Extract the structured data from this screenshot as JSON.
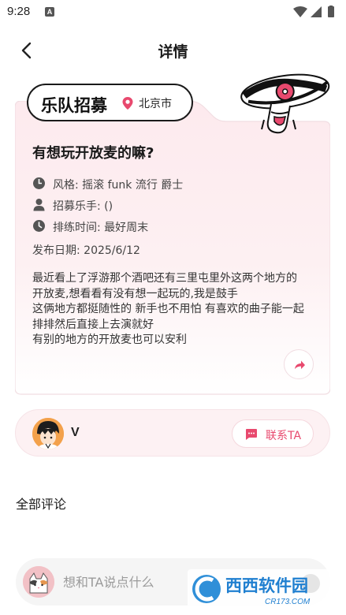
{
  "status_bar": {
    "time": "9:28",
    "notification_badge": "A",
    "icons": [
      "wifi-icon",
      "signal-icon",
      "battery-icon"
    ]
  },
  "header": {
    "title": "详情",
    "back_icon": "chevron-left-icon"
  },
  "post": {
    "tag": "乐队招募",
    "location": "北京市",
    "title": "有想玩开放麦的嘛?",
    "style_label": "风格:",
    "style_value": "摇滚 funk 流行 爵士",
    "recruit_label": "招募乐手:",
    "recruit_value": "()",
    "rehearsal_label": "排练时间:",
    "rehearsal_value": "最好周末",
    "publish_date": "发布日期:  2025/6/12",
    "body_lines": [
      "最近看上了浮游那个酒吧还有三里屯里外这两个地方的",
      "开放麦,想看看有没有想一起玩的,我是鼓手",
      "这俩地方都挺随性的 新手也不用怕 有喜欢的曲子能一起",
      "排排然后直接上去演就好",
      "有别的地方的开放麦也可以安利"
    ]
  },
  "user": {
    "name": "V",
    "contact_label": "联系TA"
  },
  "comments": {
    "heading": "全部评论",
    "input_placeholder": "想和TA说点什么"
  },
  "watermark": {
    "text_cn": "西西软件园",
    "text_url": "CR173.COM"
  },
  "colors": {
    "accent": "#e8496e",
    "card_bg_top": "#fdeef1",
    "card_bg_bottom": "#ffffff",
    "card_border": "#f3dde2"
  }
}
